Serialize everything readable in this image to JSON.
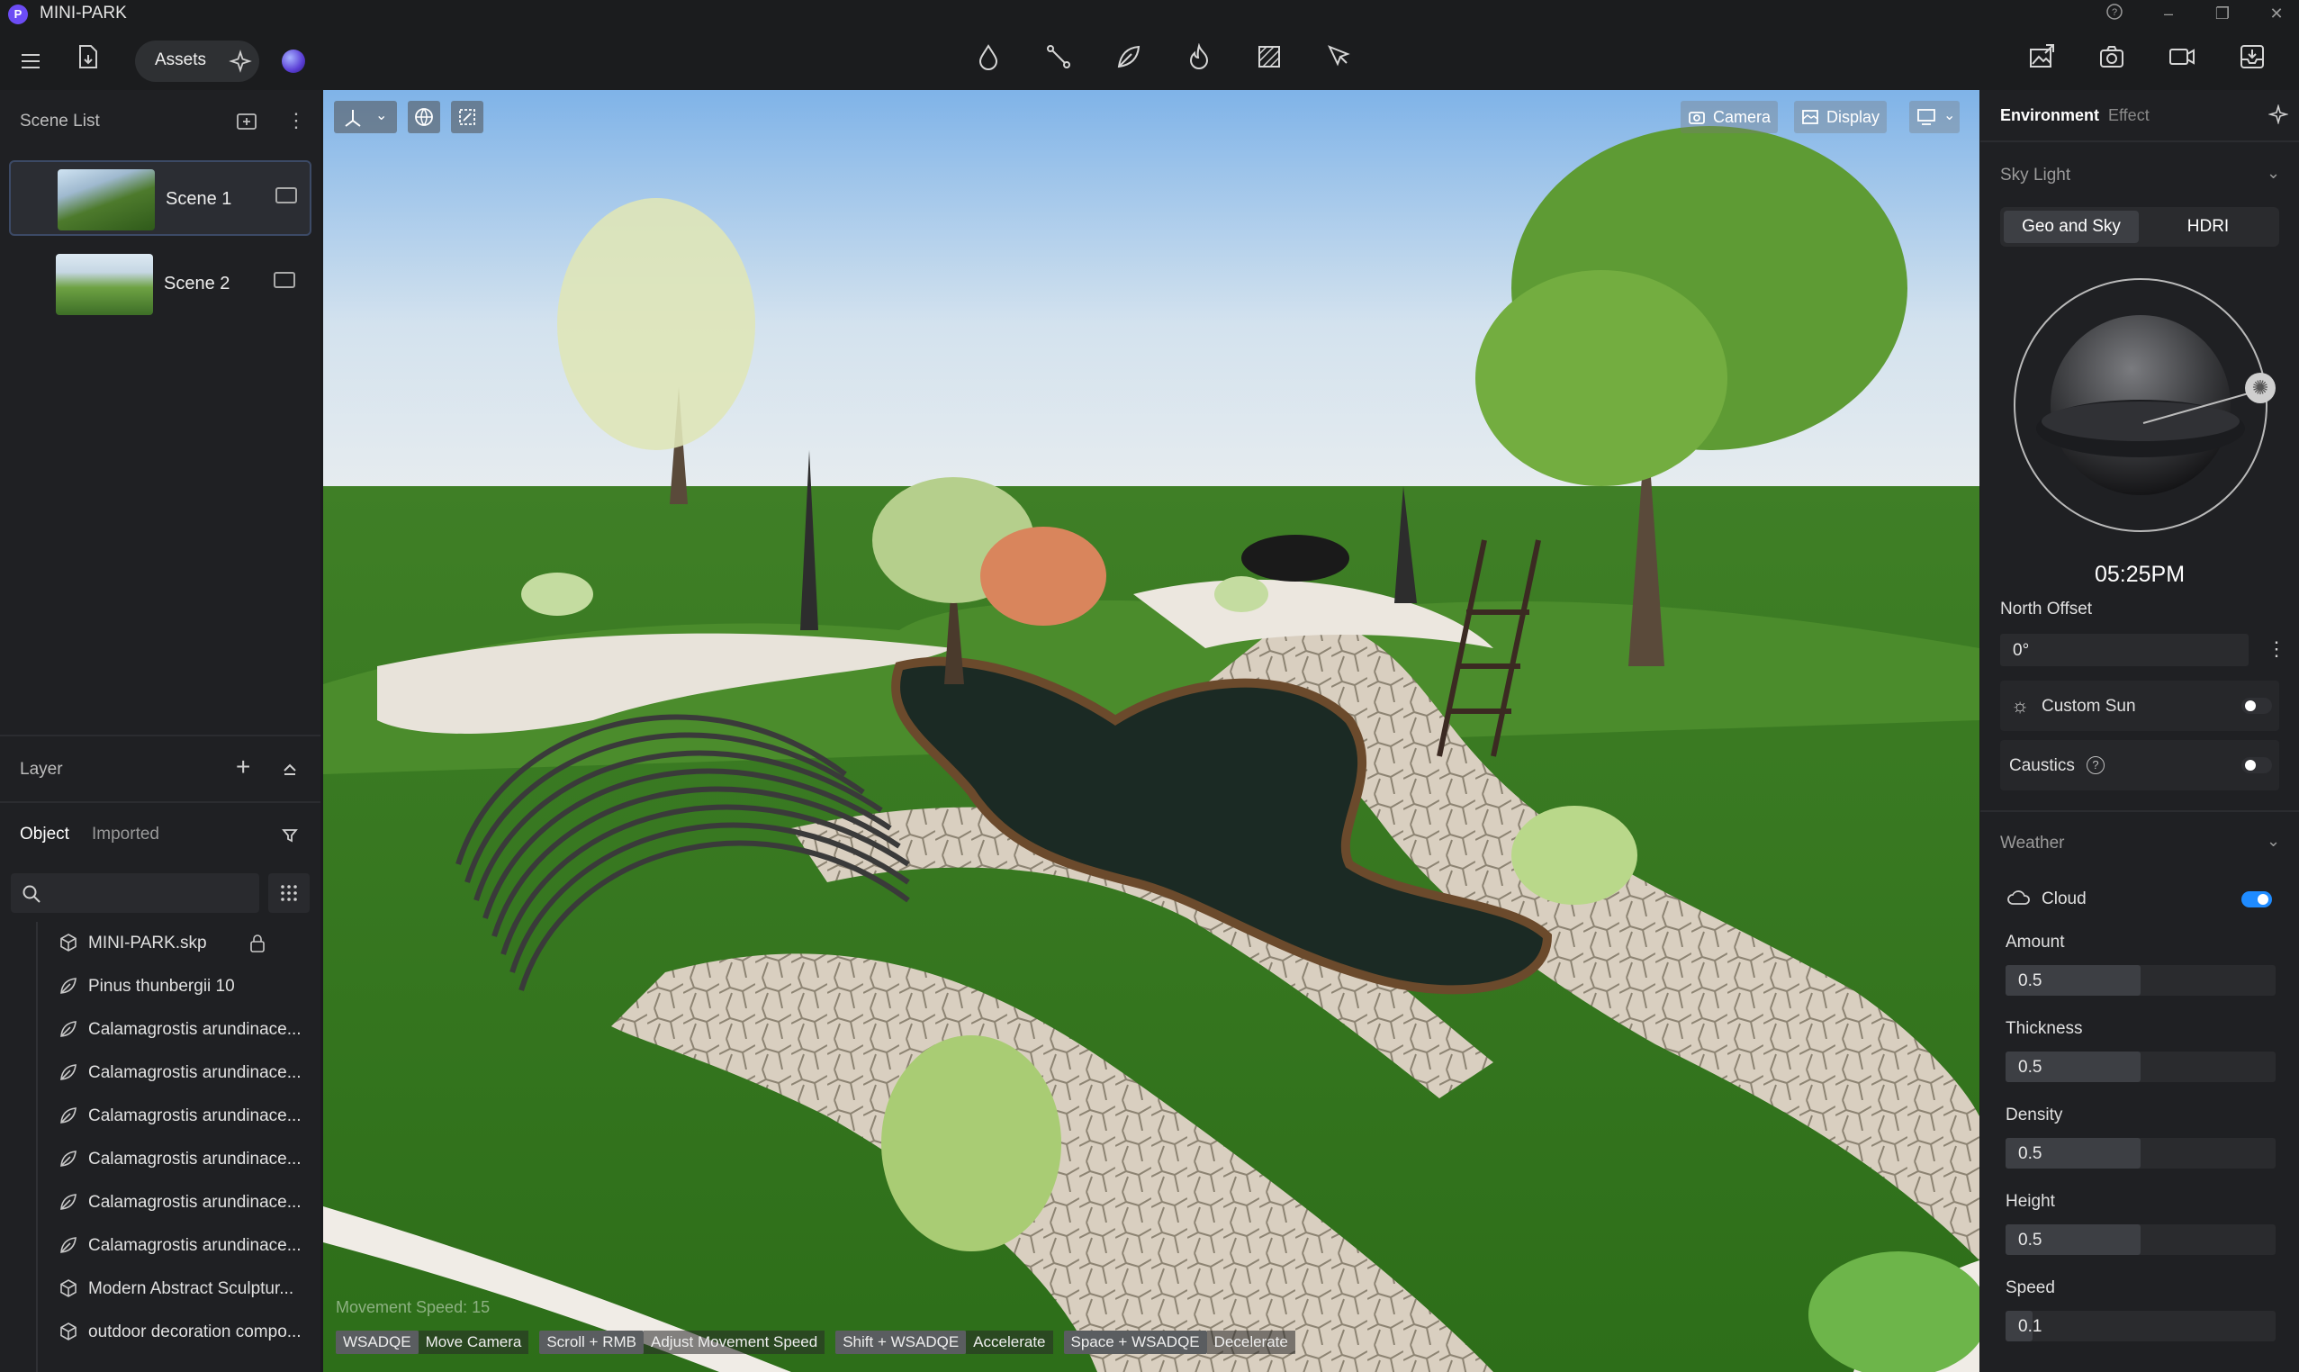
{
  "app": {
    "title": "MINI-PARK",
    "logo_letter": "P"
  },
  "window_controls": {
    "help": "?",
    "minimize": "–",
    "restore": "❐",
    "close": "✕"
  },
  "toolbar": {
    "assets_label": "Assets",
    "center_tools": [
      "water-drop",
      "path",
      "leaf",
      "fire",
      "grid-texture",
      "select-pen"
    ],
    "right_tools": [
      "export-image",
      "camera-shot",
      "video",
      "inbox"
    ]
  },
  "scene_list": {
    "title": "Scene List",
    "scenes": [
      {
        "label": "Scene 1",
        "selected": true
      },
      {
        "label": "Scene 2",
        "selected": false
      }
    ]
  },
  "layer": {
    "title": "Layer",
    "tabs": [
      "Object",
      "Imported"
    ],
    "active_tab": "Object",
    "objects": [
      {
        "label": "MINI-PARK.skp",
        "icon": "cube-icon",
        "locked": true
      },
      {
        "label": "Pinus thunbergii 10",
        "icon": "leaf-icon"
      },
      {
        "label": "Calamagrostis arundinace...",
        "icon": "leaf-icon"
      },
      {
        "label": "Calamagrostis arundinace...",
        "icon": "leaf-icon"
      },
      {
        "label": "Calamagrostis arundinace...",
        "icon": "leaf-icon"
      },
      {
        "label": "Calamagrostis arundinace...",
        "icon": "leaf-icon"
      },
      {
        "label": "Calamagrostis arundinace...",
        "icon": "leaf-icon"
      },
      {
        "label": "Calamagrostis arundinace...",
        "icon": "leaf-icon"
      },
      {
        "label": "Modern Abstract Sculptur...",
        "icon": "cube-icon"
      },
      {
        "label": "outdoor decoration compo...",
        "icon": "cube-icon"
      }
    ]
  },
  "viewport": {
    "camera_label": "Camera",
    "display_label": "Display",
    "movement_speed": "Movement Speed: 15",
    "hints": [
      {
        "key": "WSADQE",
        "text": "Move Camera"
      },
      {
        "key": "Scroll + RMB",
        "text": "Adjust Movement Speed"
      },
      {
        "key": "Shift + WSADQE",
        "text": "Accelerate"
      },
      {
        "key": "Space + WSADQE",
        "text": "Decelerate"
      }
    ]
  },
  "right_panel": {
    "tabs": [
      "Environment",
      "Effect"
    ],
    "active_tab": "Environment",
    "sky_light": {
      "title": "Sky Light",
      "modes": [
        "Geo and Sky",
        "HDRI"
      ],
      "active_mode": "Geo and Sky",
      "time": "05:25PM",
      "north_offset_label": "North Offset",
      "north_offset_value": "0°",
      "custom_sun_label": "Custom Sun",
      "custom_sun_on": false,
      "caustics_label": "Caustics",
      "caustics_on": false
    },
    "weather": {
      "title": "Weather",
      "cloud_label": "Cloud",
      "cloud_on": true,
      "params": [
        {
          "label": "Amount",
          "value": "0.5",
          "fraction": 0.5
        },
        {
          "label": "Thickness",
          "value": "0.5",
          "fraction": 0.5
        },
        {
          "label": "Density",
          "value": "0.5",
          "fraction": 0.5
        },
        {
          "label": "Height",
          "value": "0.5",
          "fraction": 0.5
        },
        {
          "label": "Speed",
          "value": "0.1",
          "fraction": 0.1
        }
      ]
    }
  },
  "colors": {
    "accent": "#1f8bff",
    "brand": "#6c4cf5",
    "panel": "#1f2023",
    "selected": "#2b2d33"
  }
}
